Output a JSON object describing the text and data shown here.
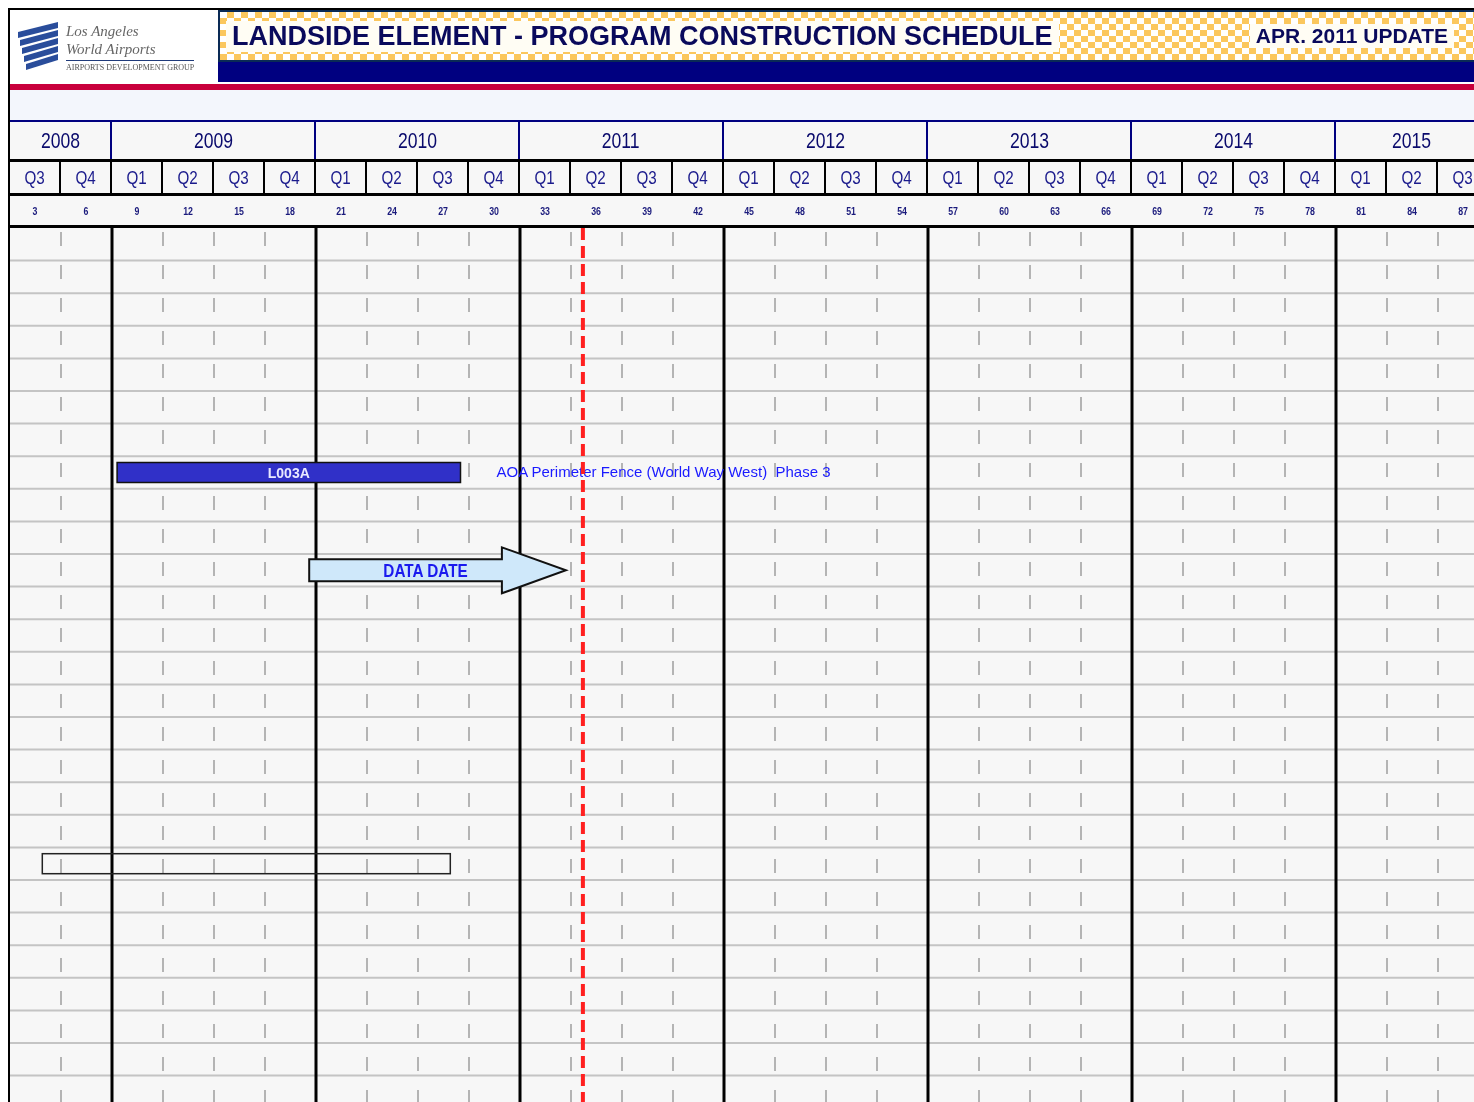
{
  "header": {
    "logo": {
      "line_1": "Los Angeles",
      "line_2": "World Airports",
      "subtitle": "AIRPORTS DEVELOPMENT GROUP"
    },
    "title": "LANDSIDE ELEMENT - PROGRAM CONSTRUCTION SCHEDULE",
    "update": "APR. 2011 UPDATE"
  },
  "timeline": {
    "years": [
      {
        "label": "2008",
        "quarters": [
          {
            "label": "Q3",
            "month": "3"
          },
          {
            "label": "Q4",
            "month": "6"
          }
        ]
      },
      {
        "label": "2009",
        "quarters": [
          {
            "label": "Q1",
            "month": "9"
          },
          {
            "label": "Q2",
            "month": "12"
          },
          {
            "label": "Q3",
            "month": "15"
          },
          {
            "label": "Q4",
            "month": "18"
          }
        ]
      },
      {
        "label": "2010",
        "quarters": [
          {
            "label": "Q1",
            "month": "21"
          },
          {
            "label": "Q2",
            "month": "24"
          },
          {
            "label": "Q3",
            "month": "27"
          },
          {
            "label": "Q4",
            "month": "30"
          }
        ]
      },
      {
        "label": "2011",
        "quarters": [
          {
            "label": "Q1",
            "month": "33"
          },
          {
            "label": "Q2",
            "month": "36"
          },
          {
            "label": "Q3",
            "month": "39"
          },
          {
            "label": "Q4",
            "month": "42"
          }
        ]
      },
      {
        "label": "2012",
        "quarters": [
          {
            "label": "Q1",
            "month": "45"
          },
          {
            "label": "Q2",
            "month": "48"
          },
          {
            "label": "Q3",
            "month": "51"
          },
          {
            "label": "Q4",
            "month": "54"
          }
        ]
      },
      {
        "label": "2013",
        "quarters": [
          {
            "label": "Q1",
            "month": "57"
          },
          {
            "label": "Q2",
            "month": "60"
          },
          {
            "label": "Q3",
            "month": "63"
          },
          {
            "label": "Q4",
            "month": "66"
          }
        ]
      },
      {
        "label": "2014",
        "quarters": [
          {
            "label": "Q1",
            "month": "69"
          },
          {
            "label": "Q2",
            "month": "72"
          },
          {
            "label": "Q3",
            "month": "75"
          },
          {
            "label": "Q4",
            "month": "78"
          }
        ]
      },
      {
        "label": "2015",
        "quarters": [
          {
            "label": "Q1",
            "month": "81"
          },
          {
            "label": "Q2",
            "month": "84"
          },
          {
            "label": "Q3",
            "month": "87"
          }
        ]
      }
    ]
  },
  "activities": [
    {
      "kind": "bar",
      "code": "L003A",
      "description": "AOA Perimeter Fence (World Way West)  Phase 3"
    },
    {
      "kind": "outline"
    }
  ],
  "data_date": {
    "label": "DATA DATE"
  }
}
